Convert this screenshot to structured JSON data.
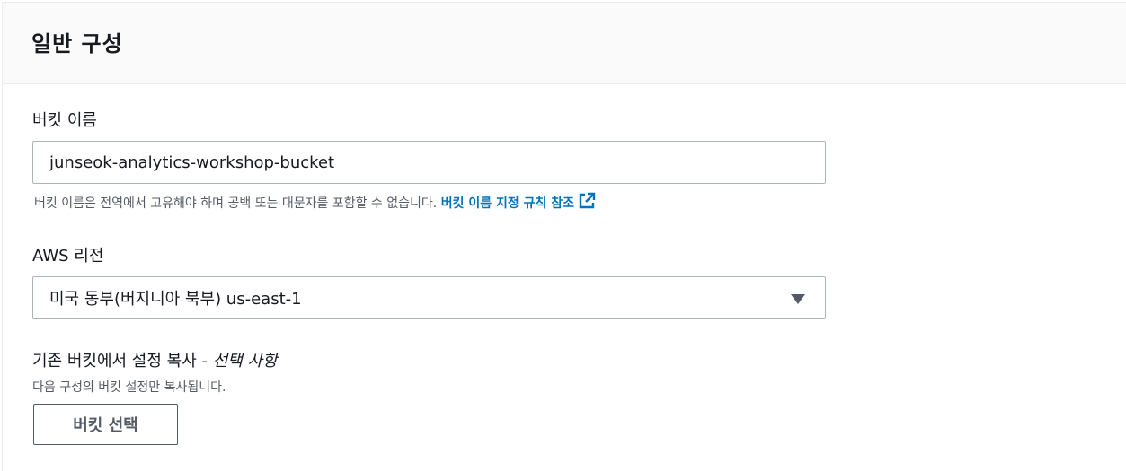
{
  "panel": {
    "title": "일반 구성"
  },
  "bucket_name": {
    "label": "버킷 이름",
    "value": "junseok-analytics-workshop-bucket",
    "hint": "버킷 이름은 전역에서 고유해야 하며 공백 또는 대문자를 포함할 수 없습니다.",
    "hint_link": "버킷 이름 지정 규칙 참조"
  },
  "region": {
    "label": "AWS 리전",
    "selected": "미국 동부(버지니아 북부) us-east-1"
  },
  "copy_settings": {
    "label": "기존 버킷에서 설정 복사 - ",
    "optional": "선택 사항",
    "hint": "다음 구성의 버킷 설정만 복사됩니다.",
    "button": "버킷 선택"
  },
  "colors": {
    "link": "#0073bb",
    "text": "#16191f",
    "muted": "#545b64",
    "border": "#aab7b8"
  }
}
